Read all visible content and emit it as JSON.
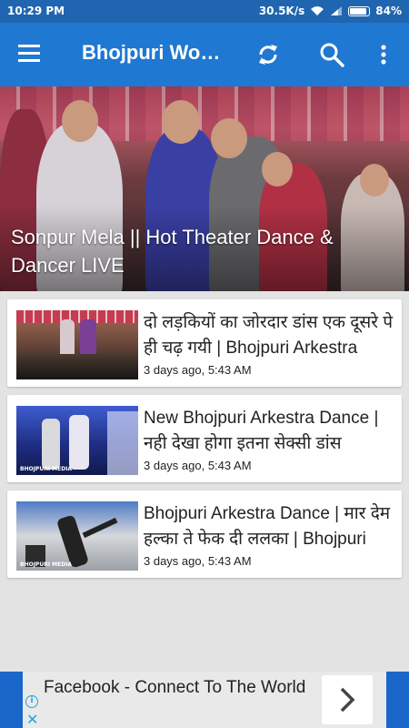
{
  "status_bar": {
    "time": "10:29 PM",
    "network_speed": "30.5K/s",
    "battery": "84%"
  },
  "app_bar": {
    "title": "Bhojpuri Wo…",
    "icons": [
      "menu-icon",
      "refresh-icon",
      "search-icon",
      "more-vert-icon"
    ]
  },
  "featured": {
    "title": "Sonpur Mela || Hot  Theater Dance & Dancer LIVE"
  },
  "videos": [
    {
      "title": "दो लड़कियों का जोरदार डांस एक दूसरे पे ही चढ़ गयी | Bhojpuri Arkestra",
      "date": "3 days ago, 5:43 AM"
    },
    {
      "title": "New Bhojpuri Arkestra Dance | नही देखा होगा इतना सेक्सी डांस",
      "date": "3 days ago, 5:43 AM",
      "watermark": "BHOJPURI MEDIA"
    },
    {
      "title": "Bhojpuri Arkestra Dance | मार देम हल्का ते फेक दी ललका | Bhojpuri",
      "date": "3 days ago, 5:43 AM",
      "watermark": "BHOJPURI MEDIA"
    }
  ],
  "ad": {
    "text": "Facebook - Connect To The World",
    "cta_icon": "chevron-right-icon",
    "colors": {
      "frame": "#1b66c9",
      "accent": "#23a3e3"
    }
  },
  "colors": {
    "status_bar": "#1f65b0",
    "app_bar": "#1f78d1",
    "background": "#e3e3e3"
  }
}
